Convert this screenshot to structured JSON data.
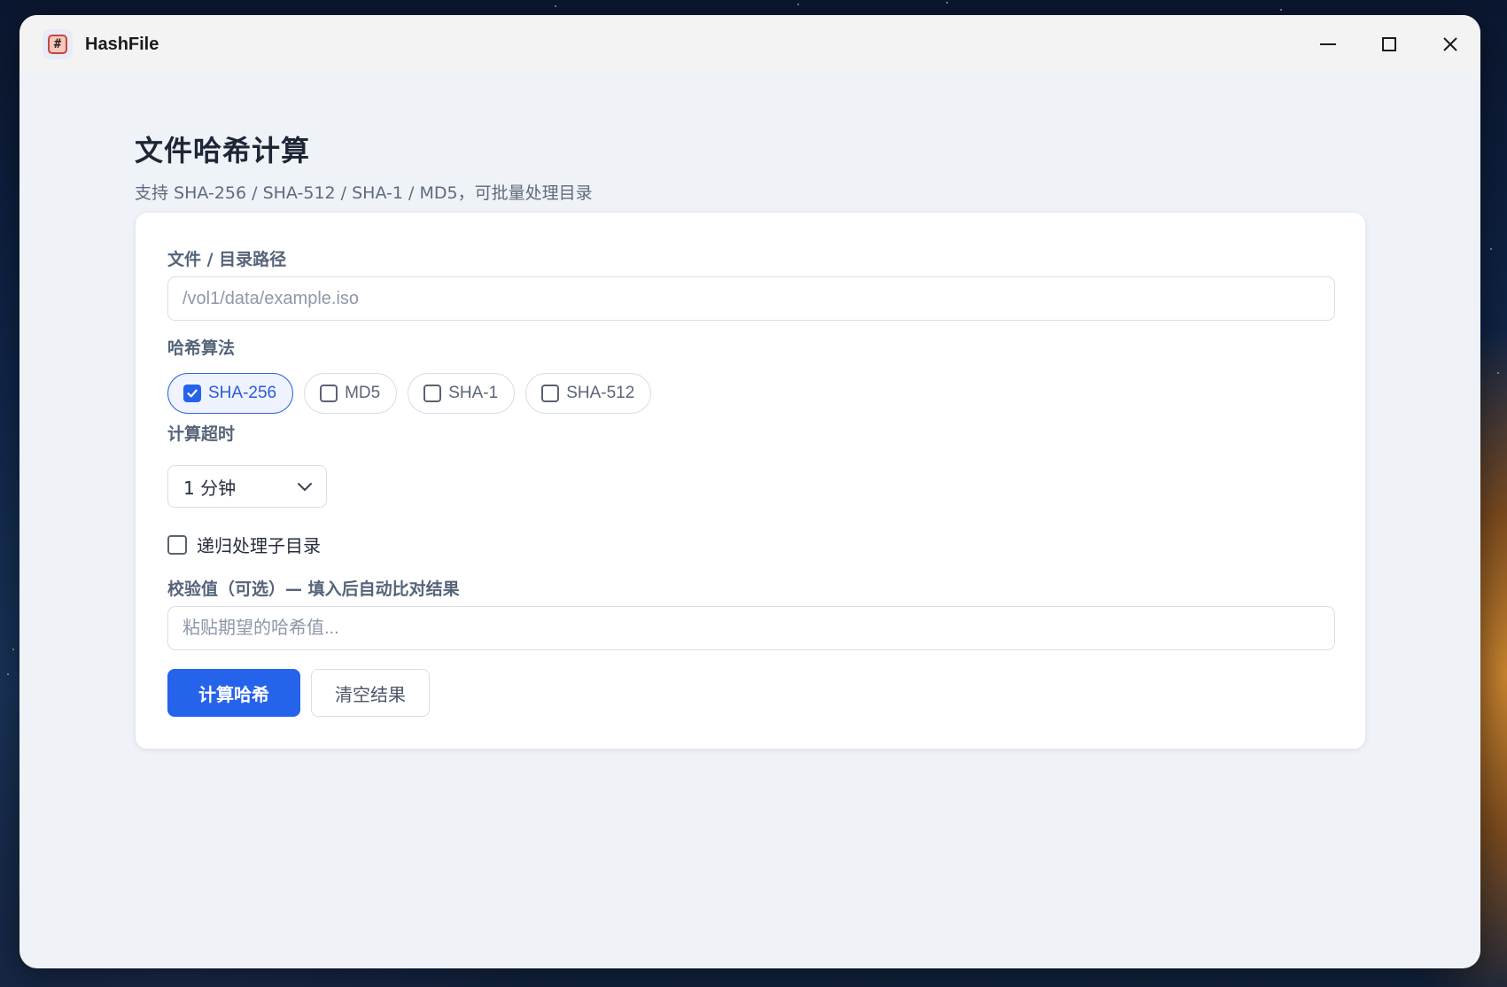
{
  "window": {
    "app_title": "HashFile",
    "app_icon": "hash-icon",
    "app_icon_glyph": "#",
    "controls": [
      "minimize-icon",
      "maximize-icon",
      "close-icon"
    ]
  },
  "page": {
    "title": "文件哈希计算",
    "subtitle": "支持 SHA-256 / SHA-512 / SHA-1 / MD5，可批量处理目录"
  },
  "form": {
    "path": {
      "label": "文件 / 目录路径",
      "placeholder": "/vol1/data/example.iso",
      "value": ""
    },
    "algorithm": {
      "label": "哈希算法",
      "options": [
        {
          "label": "SHA-256",
          "checked": true
        },
        {
          "label": "MD5",
          "checked": false
        },
        {
          "label": "SHA-1",
          "checked": false
        },
        {
          "label": "SHA-512",
          "checked": false
        }
      ]
    },
    "timeout": {
      "label": "计算超时",
      "selected": "1 分钟"
    },
    "recursive": {
      "label": "递归处理子目录",
      "checked": false
    },
    "checksum": {
      "label": "校验值（可选）— 填入后自动比对结果",
      "placeholder": "粘贴期望的哈希值...",
      "value": ""
    },
    "buttons": {
      "compute": "计算哈希",
      "clear": "清空结果"
    }
  },
  "colors": {
    "accent": "#2563eb",
    "window_bg": "#eff2f7",
    "titlebar_bg": "#f3f3f4",
    "card_bg": "#ffffff"
  }
}
